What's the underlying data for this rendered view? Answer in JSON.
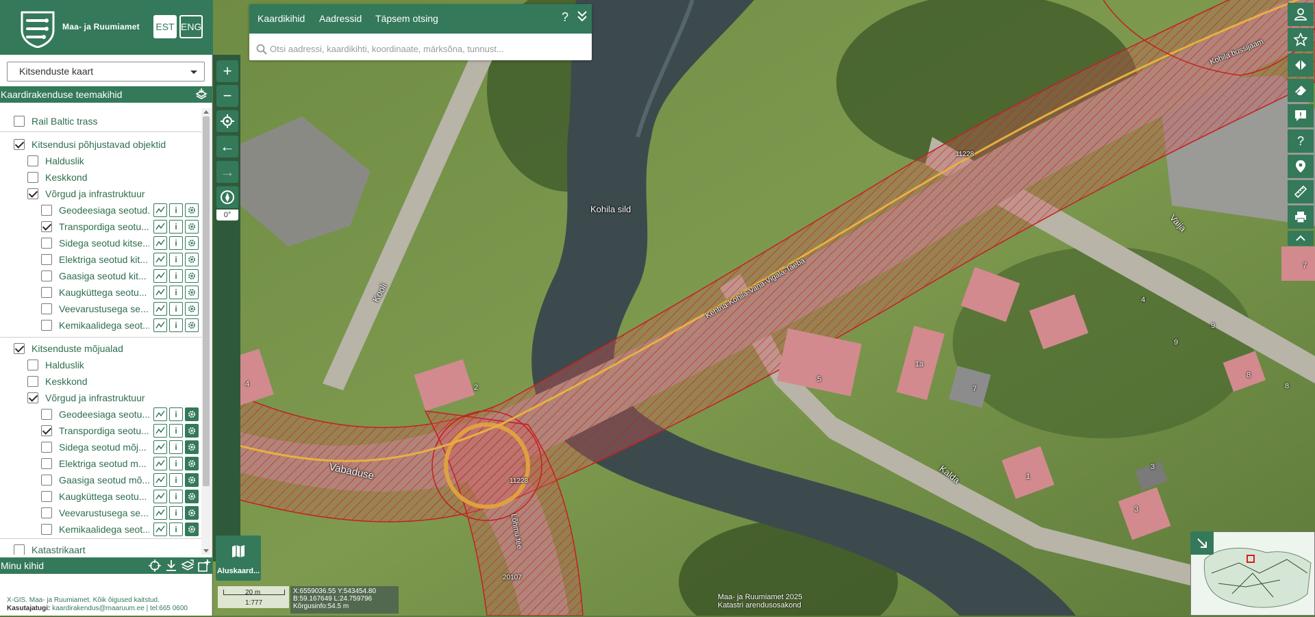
{
  "brand": {
    "name": "Maa- ja Ruumiamet",
    "lang_est": "EST",
    "lang_eng": "ENG"
  },
  "map_select": {
    "value": "Kitsenduste kaart"
  },
  "sections": {
    "thematic_title": "Kaardirakenduse teemakihid",
    "my_layers_title": "Minu kihid"
  },
  "tree": {
    "rail_baltic": "Rail Baltic trass",
    "objects_group": "Kitsendusi põhjustavad objektid",
    "objects_haldus": "Halduslik",
    "objects_keskkond": "Keskkond",
    "objects_vorgud": "Võrgud ja infrastruktuur",
    "objects_items": [
      "Geodeesiaga seotud...",
      "Transpordiga seotu...",
      "Sidega seotud kitse...",
      "Elektriga seotud kit...",
      "Gaasiga seotud kit...",
      "Kaugküttega seotu...",
      "Veevarustusega se...",
      "Kemikaalidega seot..."
    ],
    "zones_group": "Kitsenduste mõjualad",
    "zones_haldus": "Halduslik",
    "zones_keskkond": "Keskkond",
    "zones_vorgud": "Võrgud ja infrastruktuur",
    "zones_items": [
      "Geodeesiaga seotu...",
      "Transpordiga seotu...",
      "Sidega seotud mõj...",
      "Elektriga seotud m...",
      "Gaasiga seotud mõ...",
      "Kaugküttega seotu...",
      "Veevarustusega se...",
      "Kemikaalidega seot..."
    ],
    "katastri": "Katastrikaart"
  },
  "footer": {
    "copyright": "X-GIS. Maa- ja Ruumiamet. Kõik õigused kaitstud.",
    "support_label": "Kasutajatugi:",
    "support_text": "kaardirakendus@maaruum.ee | tel:665 0600"
  },
  "search": {
    "tab_cadastre": "Kaardikihid",
    "tab_address": "Aadressid",
    "tab_advanced": "Täpsem otsing",
    "help": "?",
    "placeholder": "Otsi aadressi, kaardikihti, koordinaate, märksõna, tunnust..."
  },
  "map": {
    "compass_degree": "0°",
    "basemap_label": "Aluskaard...",
    "labels": {
      "bridge": "Kohila sild",
      "street_kooli": "Kooli",
      "street_vabaduse": "Vabaduse",
      "street_kalda": "Kalda",
      "street_vaija": "Vaija",
      "street_lohmu": "Lõhmu tee",
      "road_kohila": "Kohila bussijaam",
      "road_main": "Kehtna-Kohila-Vana-Vigala-Taeba",
      "road_num_1": "11228",
      "road_num_2": "11228",
      "road_num_3": "20107",
      "house_4a": "4",
      "house_2": "2",
      "house_5": "5",
      "house_1a": "1a",
      "house_7": "7",
      "house_4b": "4",
      "house_9a": "9",
      "house_9b": "9",
      "house_8a": "8",
      "house_8b": "8",
      "house_1": "1",
      "house_3a": "3",
      "house_3b": "3",
      "house_7b": "7"
    },
    "scale_length": "20 m",
    "scale_ratio": "1:777",
    "coord_xy": "X:6559036.55 Y:543454.80",
    "coord_bl": "B:59.167649 L:24.759796",
    "coord_height": "Kõrgusinfo:54.5 m",
    "attribution_1": "Maa- ja Ruumiamet 2025",
    "attribution_2": "Katastri arendusosakond"
  },
  "colors": {
    "brand_green": "#34795a",
    "restriction_red": "#d32020"
  }
}
